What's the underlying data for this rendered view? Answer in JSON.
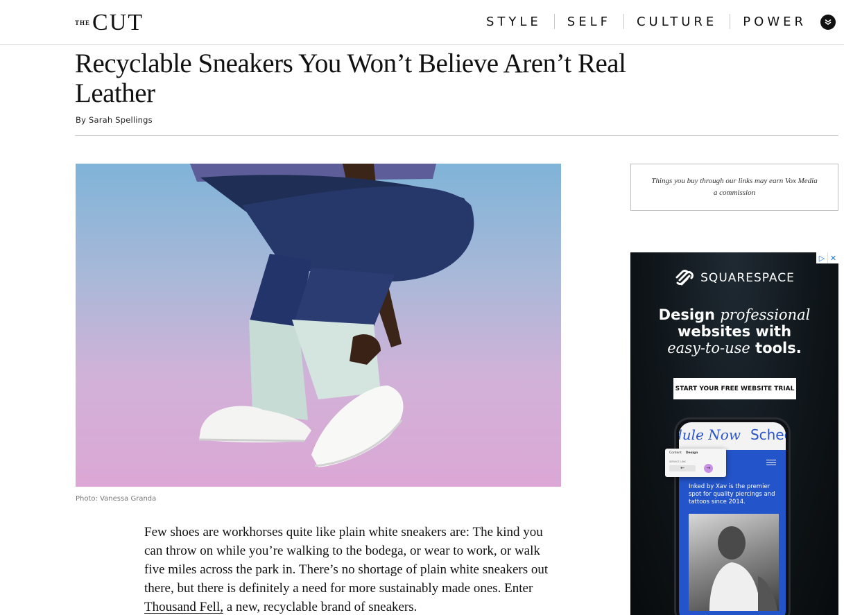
{
  "header": {
    "logo_the": "THE",
    "logo_cut": "CUT",
    "nav": [
      {
        "label": "STYLE"
      },
      {
        "label": "SELF"
      },
      {
        "label": "CULTURE"
      },
      {
        "label": "POWER"
      }
    ]
  },
  "article": {
    "headline": "Recyclable Sneakers You Won’t Believe Aren’t Real Leather",
    "byline_prefix": "By ",
    "author": "Sarah Spellings",
    "photo_credit": "Photo: Vanessa Granda",
    "body_text": "Few shoes are workhorses quite like plain white sneakers are: The kind you can throw on while you’re walking to the bodega, or wear to work, or walk five miles across the park in. There’s no shortage of plain white sneakers out there, but there is definitely a need for more sustainably made ones. Enter ",
    "body_link": "Thousand Fell,",
    "body_text_end": " a new, recyclable brand of sneakers."
  },
  "sidebar": {
    "disclaimer": "Things you buy through our links may earn Vox Media a commission"
  },
  "ad": {
    "adchoices_icon": "▷",
    "close_icon": "✕",
    "brand": "SQUARESPACE",
    "headline_1": "Design ",
    "headline_1_italic": "professional",
    "headline_2": "websites with",
    "headline_3_italic": "easy-to-use",
    "headline_3": " tools.",
    "cta": "START YOUR FREE WEBSITE TRIAL",
    "phone_marquee_1": "dule Now",
    "phone_marquee_2": "Schedu",
    "phone_copy": "Inked by Xav is the premier spot for quality piercings and tattoos since 2014.",
    "editor_tab_1": "Content",
    "editor_tab_2": "Design",
    "editor_label": "SERVICE LINK",
    "editor_back": "←",
    "editor_next": "→"
  },
  "colors": {
    "ad_background": "#0e1418",
    "phone_screen": "#2454c9",
    "accent_purple": "#c891e6"
  }
}
